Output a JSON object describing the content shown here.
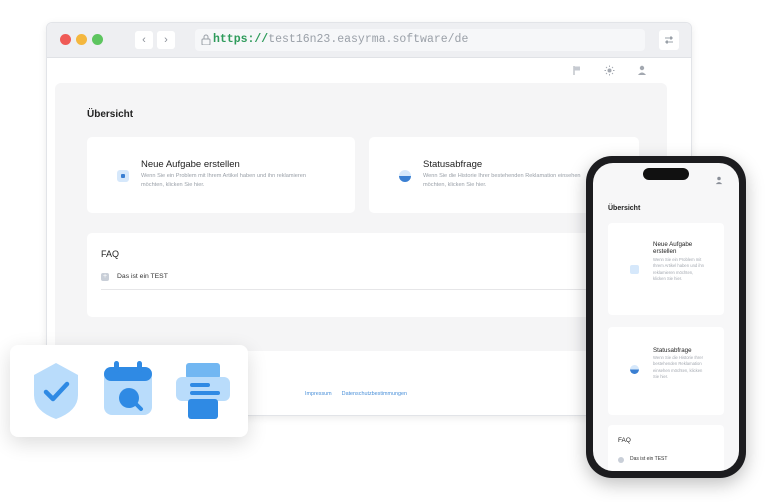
{
  "browser": {
    "back_label": "‹",
    "forward_label": "›",
    "url_protocol": "https://",
    "url_rest": "test16n23.easyrma.software/de",
    "menu_icon": "settings-sliders-icon"
  },
  "header_icons": [
    "flag-icon",
    "sun-icon",
    "user-icon"
  ],
  "page": {
    "heading": "Übersicht",
    "cards": [
      {
        "title": "Neue Aufgabe erstellen",
        "desc": "Wenn Sie ein Problem mit Ihrem Artikel haben und ihn reklamieren möchten, klicken Sie hier.",
        "icon": "plus-square-icon"
      },
      {
        "title": "Statusabfrage",
        "desc": "Wenn Sie die Historie Ihrer bestehenden Reklamation einsehen möchten, klicken Sie hier.",
        "icon": "half-circle-icon"
      }
    ],
    "faq": {
      "title": "FAQ",
      "items": [
        "Das ist ein TEST"
      ]
    },
    "footer": {
      "impressum": "Impressum",
      "datenschutz": "Datenschutzbestimmungen"
    }
  },
  "phone": {
    "heading": "Übersicht",
    "cards": [
      {
        "title": "Neue Aufgabe erstellen",
        "desc": "Wenn Sie ein Problem mit Ihrem Artikel haben und ihn reklamieren möchten, klicken Sie hier."
      },
      {
        "title": "Statusabfrage",
        "desc": "Wenn Sie die Historie Ihrer bestehenden Reklamation einsehen möchten, klicken Sie hier."
      }
    ],
    "faq_title": "FAQ",
    "faq_items": [
      "Das ist ein TEST"
    ]
  },
  "feature_icons": [
    "shield-check-icon",
    "calendar-chat-icon",
    "printer-icon"
  ],
  "colors": {
    "accent": "#4a90d9",
    "icon_light": "#b9dcfb",
    "icon_mid": "#72b7f2",
    "icon_dark": "#2f8ae4"
  }
}
